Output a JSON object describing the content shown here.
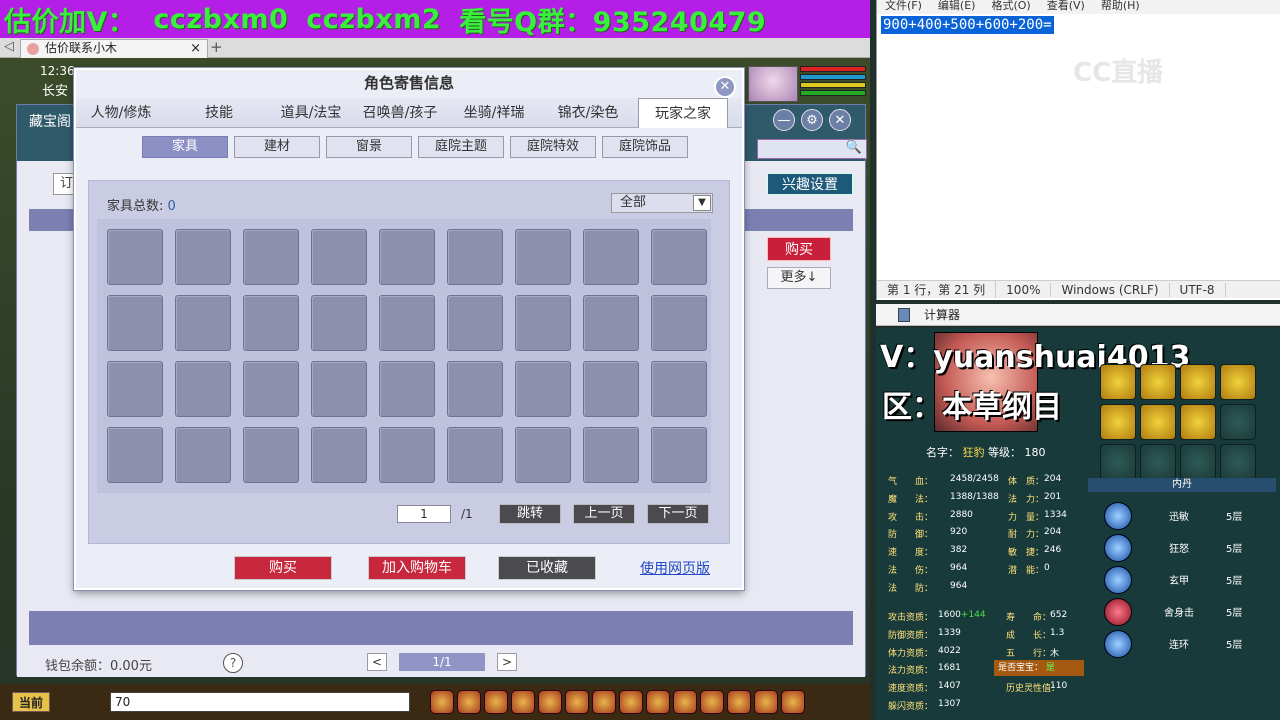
{
  "banner": {
    "items": [
      "估价加V：",
      "cczbxm0",
      "cczbxm2",
      "看号Q群：935240479"
    ]
  },
  "browser": {
    "tab_title": "估价联系小木",
    "tab_close": "×",
    "new_tab": "+",
    "back_glyph": "◁"
  },
  "game": {
    "clock": "12:36",
    "location": "长安"
  },
  "back_window": {
    "title": "藏宝阁",
    "controls": [
      "—",
      "⚙",
      "✕"
    ],
    "tab_fragment": "订",
    "interest_button": "兴趣设置",
    "buy_button": "购买",
    "more_button": "更多↓",
    "wallet_label": "钱包余额：0.00元",
    "help": "?",
    "pager_prev": "<",
    "pager_value": "1/1",
    "pager_next": ">"
  },
  "bottom_bar": {
    "current_button": "当前",
    "chat_value": "70"
  },
  "modal": {
    "title": "角色寄售信息",
    "close": "✕",
    "tabs": [
      {
        "label": "人物/修炼",
        "width": 90
      },
      {
        "label": "技能",
        "width": 106
      },
      {
        "label": "道具/法宝",
        "width": 78
      },
      {
        "label": "召唤兽/孩子",
        "width": 100
      },
      {
        "label": "坐骑/祥瑞",
        "width": 88
      },
      {
        "label": "锦衣/染色",
        "width": 100
      },
      {
        "label": "玩家之家",
        "width": 90
      }
    ],
    "subtabs": [
      "家具",
      "建材",
      "窗景",
      "庭院主题",
      "庭院特效",
      "庭院饰品"
    ],
    "count_label": "家具总数:",
    "count_value": "0",
    "filter_value": "全部",
    "page_input": "1",
    "page_total": "/1",
    "jump_button": "跳转",
    "prev_page_button": "上一页",
    "next_page_button": "下一页",
    "buy_button": "购买",
    "add_cart_button": "加入购物车",
    "favorited_button": "已收藏",
    "web_version_link": "使用网页版",
    "colors": {
      "buy": "#c8283e",
      "cart": "#c8283e",
      "favorited": "#4b4b4f"
    }
  },
  "notepad": {
    "menu": [
      "文件(F)",
      "编辑(E)",
      "格式(O)",
      "查看(V)",
      "帮助(H)"
    ],
    "selected_text": "900+400+500+600+200=",
    "watermark": "CC直播",
    "status": [
      "第 1 行，第 21 列",
      "100%",
      "Windows (CRLF)",
      "UTF-8"
    ]
  },
  "calculator": {
    "title": "计算器"
  },
  "character": {
    "overlay_v": "V：yuanshuai4013",
    "overlay_zone": "区：本草纲目",
    "name_label": "名字：",
    "name_value": "狂豹",
    "level_label": "等级：",
    "level_value": "180",
    "stats": [
      {
        "k1": "气　　血：",
        "v1": "2458/2458",
        "k2": "体　质：",
        "v2": "204"
      },
      {
        "k1": "魔　　法：",
        "v1": "1388/1388",
        "k2": "法　力：",
        "v2": "201"
      },
      {
        "k1": "攻　　击：",
        "v1": "2880",
        "k2": "力　量：",
        "v2": "1334"
      },
      {
        "k1": "防　　御：",
        "v1": "920",
        "k2": "耐　力：",
        "v2": "204"
      },
      {
        "k1": "速　　度：",
        "v1": "382",
        "k2": "敏　捷：",
        "v2": "246"
      },
      {
        "k1": "法　　伤：",
        "v1": "964",
        "k2": "潜　能：",
        "v2": "0"
      },
      {
        "k1": "法　　防：",
        "v1": "964",
        "k2": "",
        "v2": ""
      }
    ],
    "qualities": [
      {
        "k": "攻击资质：",
        "v": "1600",
        "add": "+144",
        "k3": "寿　　命：",
        "v3": "652"
      },
      {
        "k": "防御资质：",
        "v": "1339",
        "add": "",
        "k3": "成　　长：",
        "v3": "1.3"
      },
      {
        "k": "体力资质：",
        "v": "4022",
        "add": "",
        "k3": "五　　行：",
        "v3": "木"
      },
      {
        "k": "法力资质：",
        "v": "1681",
        "add": "",
        "k3": "",
        "v3": ""
      },
      {
        "k": "速度资质：",
        "v": "1407",
        "add": "",
        "k3": "历史灵性值：",
        "v3": "110"
      },
      {
        "k": "躲闪资质：",
        "v": "1307",
        "add": "",
        "k3": "",
        "v3": ""
      }
    ],
    "baby_label": "是否宝宝：",
    "baby_value": "是",
    "neidan_title": "内丹",
    "neidan": [
      {
        "name": "迅敏",
        "level": "5层"
      },
      {
        "name": "狂怒",
        "level": "5层"
      },
      {
        "name": "玄甲",
        "level": "5层"
      },
      {
        "name": "舍身击",
        "level": "5层"
      },
      {
        "name": "连环",
        "level": "5层"
      }
    ]
  }
}
